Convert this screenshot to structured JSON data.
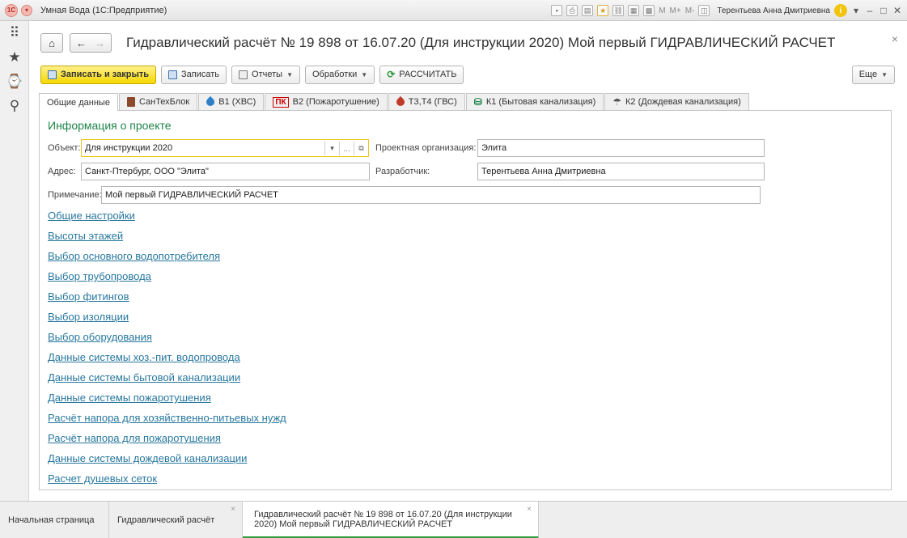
{
  "window": {
    "title": "Умная Вода  (1С:Предприятие)",
    "user": "Терентьева Анна Дмитриевна",
    "toolbar_m": [
      "M",
      "M+",
      "M-"
    ]
  },
  "page": {
    "title": "Гидравлический расчёт № 19 898 от 16.07.20 (Для инструкции 2020) Мой первый ГИДРАВЛИЧЕСКИЙ РАСЧЕТ"
  },
  "toolbar": {
    "save_close": "Записать и закрыть",
    "save": "Записать",
    "reports": "Отчеты",
    "processing": "Обработки",
    "calculate": "РАССЧИТАТЬ",
    "more": "Еще"
  },
  "tabs": [
    {
      "label": "Общие данные"
    },
    {
      "label": "СанТехБлок"
    },
    {
      "label": "В1 (ХВС)"
    },
    {
      "label": "В2 (Пожаротушение)",
      "badge": "ПК"
    },
    {
      "label": "Т3,Т4 (ГВС)"
    },
    {
      "label": "К1 (Бытовая канализация)"
    },
    {
      "label": "К2 (Дождевая канализация)"
    }
  ],
  "project": {
    "section_title": "Информация о проекте",
    "object_label": "Объект:",
    "object_value": "Для инструкции 2020",
    "org_label": "Проектная организация:",
    "org_value": "Элита",
    "address_label": "Адрес:",
    "address_value": "Санкт-Птербург, ООО \"Элита\"",
    "developer_label": "Разработчик:",
    "developer_value": "Терентьева Анна Дмитриевна",
    "note_label": "Примечание:",
    "note_value": "Мой первый ГИДРАВЛИЧЕСКИЙ РАСЧЕТ"
  },
  "links": [
    "Общие настройки",
    "Высоты этажей",
    "Выбор основного водопотребителя",
    "Выбор трубопровода",
    "Выбор фитингов",
    "Выбор изоляции",
    "Выбор оборудования",
    "Данные системы хоз.-пит. водопровода",
    "Данные системы бытовой канализации",
    "Данные системы пожаротушения",
    "Расчёт напора для хозяйственно-питьевых нужд",
    "Расчёт напора для пожаротушения",
    "Данные системы дождевой канализации",
    "Расчет душевых сеток"
  ],
  "bottom_tabs": [
    {
      "label": "Начальная страница"
    },
    {
      "label": "Гидравлический расчёт"
    },
    {
      "label_line1": "Гидравлический расчёт № 19 898 от 16.07.20 (Для инструкции",
      "label_line2": "2020) Мой первый ГИДРАВЛИЧЕСКИЙ РАСЧЕТ"
    }
  ],
  "colors": {
    "link": "#27779e",
    "section_title": "#1e8449",
    "primary_button": "#f5d800",
    "active_tab_underline": "#2e9b3c"
  }
}
